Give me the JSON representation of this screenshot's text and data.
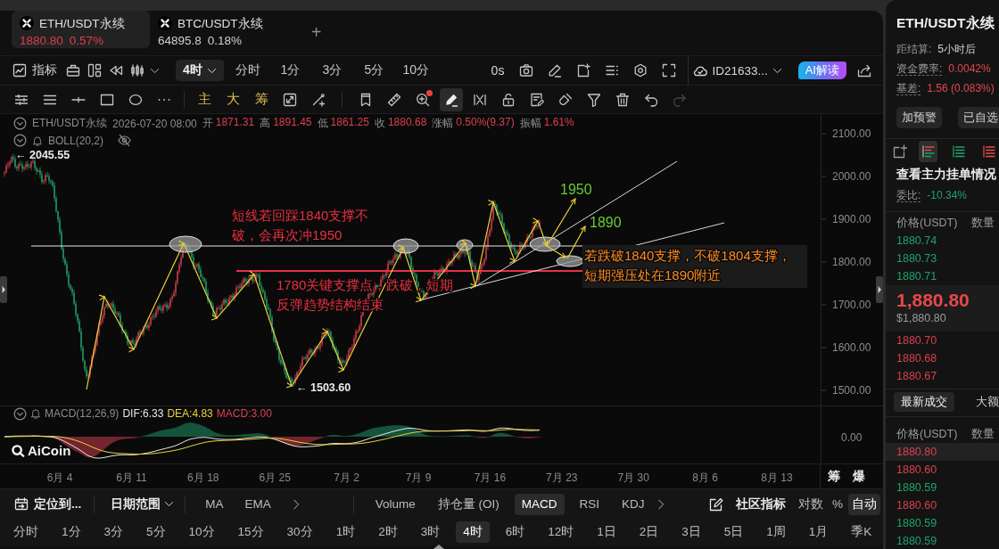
{
  "symbol_tabs": [
    {
      "name": "ETH/USDT永续",
      "price": "1880.80",
      "change": "0.57%",
      "color": "#d9404f",
      "selected": true
    },
    {
      "name": "BTC/USDT永续",
      "price": "64895.8",
      "change": "0.18%",
      "color": "#cfcfcf",
      "selected": false
    }
  ],
  "add_tab": "+",
  "toolbar": {
    "indicators": "指标",
    "interval": "4时",
    "quick_intervals": [
      {
        "label": "分时",
        "selected": false
      },
      {
        "label": "1分",
        "selected": false
      },
      {
        "label": "3分",
        "selected": false
      },
      {
        "label": "5分",
        "selected": false
      },
      {
        "label": "10分",
        "selected": false
      }
    ],
    "refresh": "0s",
    "account": "ID21633...",
    "ai_button": "AI解读"
  },
  "draw_toolbar": {
    "chips": [
      "主",
      "大",
      "筹"
    ],
    "alert_dot": true,
    "pen_on": true,
    "redo_disabled": true
  },
  "chart_header": {
    "symbol": "ETH/USDT永续",
    "time": "2026-07-20 08:00",
    "stats": [
      {
        "label": "开",
        "value": "1871.31"
      },
      {
        "label": "高",
        "value": "1891.45"
      },
      {
        "label": "低",
        "value": "1861.25"
      },
      {
        "label": "收",
        "value": "1880.68"
      },
      {
        "label": "涨幅",
        "value": "0.50%(9.37)"
      },
      {
        "label": "振幅",
        "value": "1.61%"
      }
    ],
    "overlay": "BOLL(20,2)",
    "overlay_hidden": true
  },
  "price_chart": {
    "high_label": "← 2045.55",
    "low_label": "← 1503.60",
    "notes": [
      {
        "color": "#e8303f",
        "lines": [
          "短线若回踩1840支撑不",
          "破，会再次冲1950"
        ],
        "backdrop": false
      },
      {
        "color": "#e8303f",
        "lines": [
          "1780关键支撑点，跌破，短期",
          "反弹趋势结构结束"
        ],
        "backdrop": false
      },
      {
        "color": "#66cc33",
        "lines": [
          "1950"
        ],
        "backdrop": false
      },
      {
        "color": "#66cc33",
        "lines": [
          "1890"
        ],
        "backdrop": false
      },
      {
        "color": "#ff8a1f",
        "lines": [
          "若跌破1840支撑，不破1804支撑，",
          "短期强压处在1890附近"
        ],
        "backdrop": true
      }
    ],
    "price_axis": [
      "2100.00",
      "2000.00",
      "1900.00",
      "1800.00",
      "1700.00",
      "1600.00",
      "1500.00"
    ]
  },
  "macd": {
    "name": "MACD(12,26,9)",
    "readings": [
      {
        "text": "DIF:6.33",
        "color": "#e6e6e6"
      },
      {
        "text": "DEA:4.83",
        "color": "#e8d23c"
      },
      {
        "text": "MACD:3.00",
        "color": "#d9404f"
      }
    ],
    "axis_label": "0.00",
    "logo": "AiCoin"
  },
  "date_axis": [
    "6月 4",
    "6月 11",
    "6月 18",
    "6月 25",
    "7月 2",
    "7月 9",
    "7月 16",
    "7月 23",
    "7月 30",
    "8月 6",
    "8月 13"
  ],
  "axis_buttons": [
    "筹",
    "爆"
  ],
  "bottom_bar": {
    "locate": "定位到...",
    "date_range": "日期范围",
    "overlays": [
      {
        "label": "MA",
        "selected": false
      },
      {
        "label": "EMA",
        "selected": false
      }
    ],
    "indicators": [
      {
        "label": "Volume",
        "selected": false
      },
      {
        "label": "持仓量 (OI)",
        "selected": false
      },
      {
        "label": "MACD",
        "selected": true
      },
      {
        "label": "RSI",
        "selected": false
      },
      {
        "label": "KDJ",
        "selected": false
      }
    ],
    "community": "社区指标",
    "scale_modes": [
      {
        "label": "对数",
        "selected": false
      },
      {
        "label": "%",
        "selected": false
      },
      {
        "label": "自动",
        "selected": true
      }
    ]
  },
  "intervals": [
    {
      "label": "分时",
      "selected": false
    },
    {
      "label": "1分",
      "selected": false
    },
    {
      "label": "3分",
      "selected": false
    },
    {
      "label": "5分",
      "selected": false
    },
    {
      "label": "10分",
      "selected": false
    },
    {
      "label": "15分",
      "selected": false
    },
    {
      "label": "30分",
      "selected": false
    },
    {
      "label": "1时",
      "selected": false
    },
    {
      "label": "2时",
      "selected": false
    },
    {
      "label": "3时",
      "selected": false
    },
    {
      "label": "4时",
      "selected": true
    },
    {
      "label": "6时",
      "selected": false
    },
    {
      "label": "12时",
      "selected": false
    },
    {
      "label": "1日",
      "selected": false
    },
    {
      "label": "2日",
      "selected": false
    },
    {
      "label": "3日",
      "selected": false
    },
    {
      "label": "5日",
      "selected": false
    },
    {
      "label": "1周",
      "selected": false
    },
    {
      "label": "1月",
      "selected": false
    },
    {
      "label": "季K",
      "selected": false
    }
  ],
  "side": {
    "title": "ETH/USDT永续",
    "info": [
      {
        "label": "距结算:",
        "value": "5小时后",
        "color": "#cfcfcf",
        "kind": "plain"
      },
      {
        "label": "资金费率:",
        "value": "0.0042%",
        "color": "#e5484d",
        "kind": "underlined"
      },
      {
        "label": "基差:",
        "value": "1.56 (0.083%)",
        "color": "#e5484d",
        "kind": "underlined"
      }
    ],
    "buttons": [
      "加预警",
      "已自选"
    ],
    "book_views": [
      {
        "selected": true
      },
      {
        "selected": false
      },
      {
        "selected": false
      }
    ],
    "book_title": "查看主力挂单情况",
    "ratio": {
      "label": "委比:",
      "value": "-10.34%"
    },
    "book_columns": [
      "价格(USDT)",
      "数量"
    ],
    "asks": [
      {
        "price": "1880.74",
        "color": "#1fa36b"
      },
      {
        "price": "1880.73",
        "color": "#1fa36b"
      },
      {
        "price": "1880.71",
        "color": "#1fa36b"
      }
    ],
    "last_price": "1,880.80",
    "last_price_usd": "$1,880.80",
    "bids": [
      {
        "price": "1880.70",
        "color": "#d9404f"
      },
      {
        "price": "1880.68",
        "color": "#d9404f"
      },
      {
        "price": "1880.67",
        "color": "#d9404f"
      }
    ],
    "trade_tabs": [
      {
        "label": "最新成交",
        "selected": true
      },
      {
        "label": "大额",
        "selected": false
      }
    ],
    "trade_columns": [
      "价格(USDT)",
      "数量"
    ],
    "trades": [
      {
        "price": "1880.80",
        "color": "#d9404f",
        "highlighted": true
      },
      {
        "price": "1880.60",
        "color": "#d9404f",
        "highlighted": false
      },
      {
        "price": "1880.59",
        "color": "#1fa36b",
        "highlighted": false
      },
      {
        "price": "1880.60",
        "color": "#d9404f",
        "highlighted": false
      },
      {
        "price": "1880.59",
        "color": "#1fa36b",
        "highlighted": false
      },
      {
        "price": "1880.59",
        "color": "#1fa36b",
        "highlighted": false
      }
    ]
  }
}
